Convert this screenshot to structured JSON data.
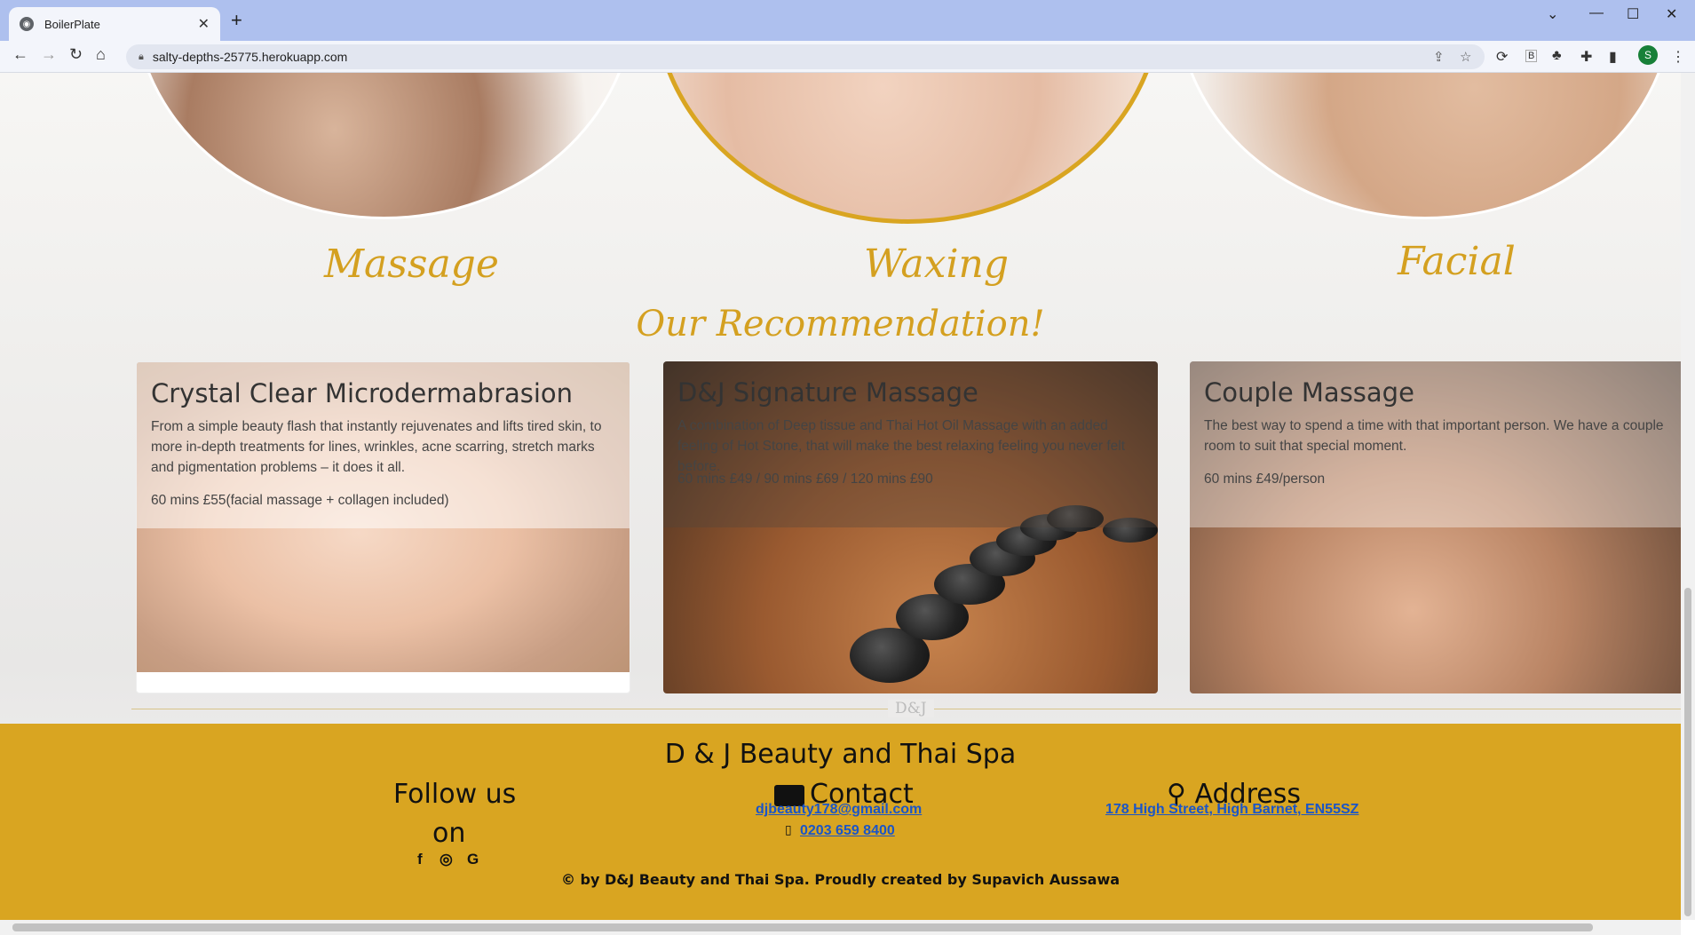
{
  "browser": {
    "tab_title": "BoilerPlate",
    "url": "salty-depths-25775.herokuapp.com",
    "profile_initial": "S"
  },
  "services": [
    {
      "title": "Massage"
    },
    {
      "title": "Waxing"
    },
    {
      "title": "Facial"
    }
  ],
  "recommendation_heading": "Our Recommendation!",
  "cards": [
    {
      "title": "Crystal Clear Microdermabrasion",
      "description": "From a simple beauty flash that instantly rejuvenates and lifts tired skin, to more in-depth treatments for lines, wrinkles, acne scarring, stretch marks and pigmentation problems – it does it all.",
      "price": "60 mins £55(facial massage + collagen included)"
    },
    {
      "title": "D&J Signature Massage",
      "description": "A combination of Deep tissue and Thai Hot Oil Massage with an added feeling of Hot Stone, that will make the best relaxing feeling you never felt before.",
      "price": "60 mins £49 / 90 mins £69 / 120 mins £90"
    },
    {
      "title": "Couple Massage",
      "description": "The best way to spend a time with that important person. We have a couple room to suit that special moment.",
      "price": "60 mins £49/person"
    }
  ],
  "divider_text": "D&J",
  "footer": {
    "business_name": "D & J Beauty and Thai Spa",
    "follow_line1": "Follow us",
    "follow_line2": "on",
    "contact_title": "Contact",
    "address_title": "Address",
    "email": "djbeauty178@gmail.com",
    "phone": "0203 659 8400",
    "address": "178 High Street, High Barnet, EN55SZ",
    "copyright": "© by D&J Beauty and Thai Spa. Proudly created by Supavich Aussawa"
  },
  "icons": {
    "facebook": "f",
    "instagram": "◎",
    "google": "G"
  },
  "colors": {
    "accent_gold": "#d9a521",
    "link_blue": "#1a55c8"
  }
}
